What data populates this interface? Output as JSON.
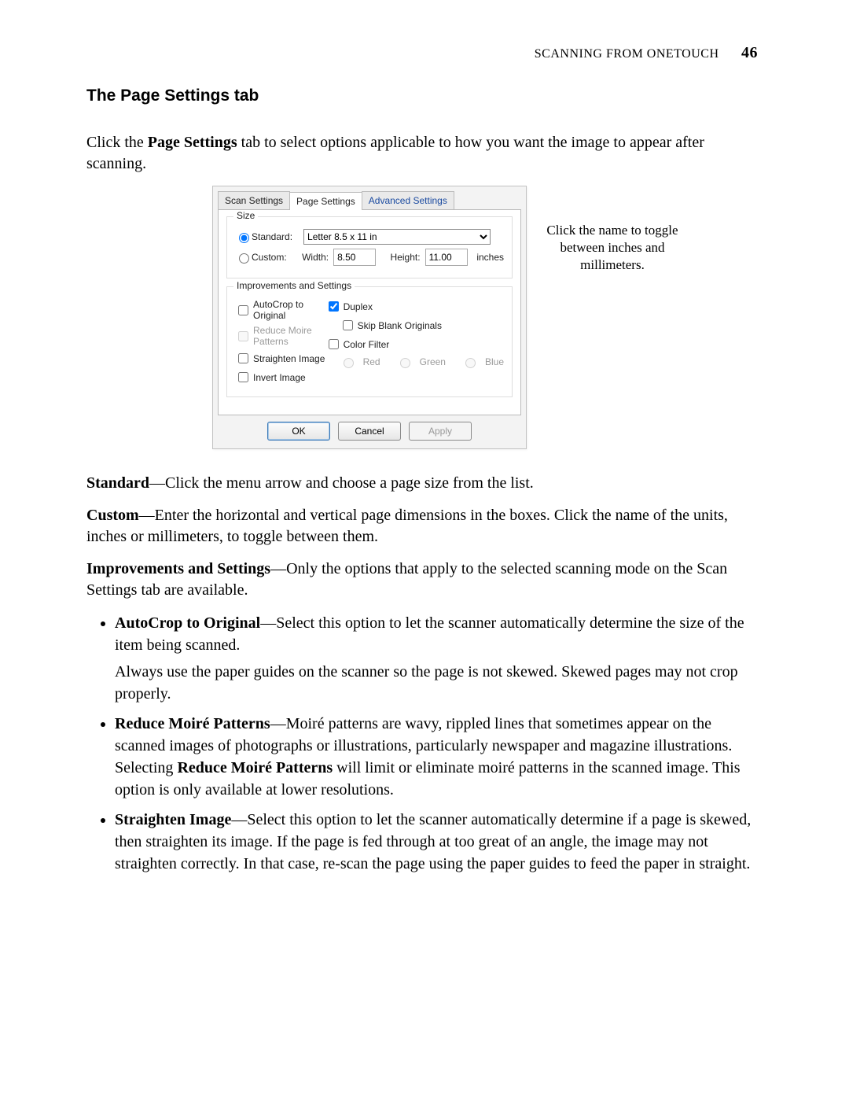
{
  "header": {
    "running_head": "SCANNING FROM ONETOUCH",
    "page_number": "46"
  },
  "section": {
    "title": "The Page Settings tab",
    "intro_before_bold": "Click the ",
    "intro_bold": "Page Settings",
    "intro_after_bold": " tab to select options applicable to how you want the image to appear after scanning."
  },
  "dialog": {
    "tabs": {
      "scan_settings": "Scan Settings",
      "page_settings": "Page Settings",
      "advanced_settings": "Advanced Settings"
    },
    "size": {
      "group_label": "Size",
      "standard_label": "Standard:",
      "standard_value": "Letter 8.5 x 11 in",
      "custom_label": "Custom:",
      "width_label": "Width:",
      "width_value": "8.50",
      "height_label": "Height:",
      "height_value": "11.00",
      "units": "inches"
    },
    "improvements": {
      "group_label": "Improvements and Settings",
      "autocrop": "AutoCrop to Original",
      "reduce_moire": "Reduce Moire Patterns",
      "straighten": "Straighten Image",
      "invert": "Invert Image",
      "duplex": "Duplex",
      "skip_blank": "Skip Blank Originals",
      "color_filter": "Color Filter",
      "red": "Red",
      "green": "Green",
      "blue": "Blue"
    },
    "buttons": {
      "ok": "OK",
      "cancel": "Cancel",
      "apply": "Apply"
    }
  },
  "annotation": "Click the name to toggle between inches and millimeters.",
  "paras": {
    "standard_bold": "Standard",
    "standard_text": "—Click the menu arrow and choose a page size from the list.",
    "custom_bold": "Custom",
    "custom_text": "—Enter the horizontal and vertical page dimensions in the boxes. Click the name of the units, inches or millimeters, to toggle between them.",
    "improve_bold": "Improvements and Settings",
    "improve_text": "—Only the options that apply to the selected scanning mode on the Scan Settings tab are available."
  },
  "bullets": {
    "autocrop_bold": "AutoCrop to Original",
    "autocrop_text": "—Select this option to let the scanner automatically determine the size of the item being scanned.",
    "autocrop_note": "Always use the paper guides on the scanner so the page is not skewed. Skewed pages may not crop properly.",
    "moire_bold": "Reduce Moiré Patterns",
    "moire_text_a": "—Moiré patterns are wavy, rippled lines that sometimes appear on the scanned images of photographs or illustrations, particularly newspaper and magazine illustrations. Selecting ",
    "moire_inline_bold": "Reduce Moiré Patterns",
    "moire_text_b": " will limit or eliminate moiré patterns in the scanned image. This option is only available at lower resolutions.",
    "straighten_bold": "Straighten Image",
    "straighten_text": "—Select this option to let the scanner automatically determine if a page is skewed, then straighten its image. If the page is fed through at too great of an angle, the image may not straighten correctly. In that case, re-scan the page using the paper guides to feed the paper in straight."
  }
}
